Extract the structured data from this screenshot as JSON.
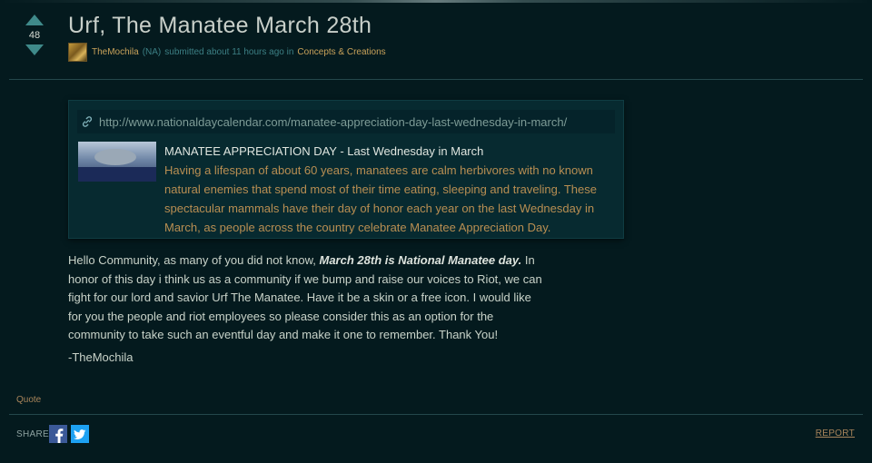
{
  "post": {
    "score": "48",
    "title": "Urf, The Manatee March 28th",
    "author": "TheMochila",
    "region": "(NA)",
    "submitted": "submitted about 11 hours ago in",
    "board": "Concepts & Creations"
  },
  "embed": {
    "url": "http://www.nationaldaycalendar.com/manatee-appreciation-day-last-wednesday-in-march/",
    "headline": "MANATEE APPRECIATION DAY - Last Wednesday in March",
    "description": "Having a lifespan of about 60 years, manatees are calm herbivores with no known natural enemies that spend most of their time eating, sleeping and traveling. These spectacular mammals have their day of honor each year on the last Wednesday in March, as people across the country celebrate Manatee Appreciation Day.",
    "thumbnail_text": "Manatee Appreciation Day - Last Wednesday in March"
  },
  "body": {
    "intro": "Hello Community, as many of you did not know, ",
    "emphasis": "March 28th is National Manatee day.",
    "rest": " In honor of this day i think us as a community if we bump and raise our voices to Riot, we can fight for our lord and savior Urf The Manatee. Have it be a skin or a free icon. I would like for you the people and riot employees so please consider this as an option for the community to take such an eventful day and make it one to remember. Thank You!",
    "signoff": "-TheMochila"
  },
  "footer": {
    "quote": "Quote",
    "share": "SHARE",
    "facebook_icon": "f",
    "report": "REPORT"
  },
  "colors": {
    "background": "#041a1e",
    "accent_gold": "#c9a25a",
    "accent_teal": "#3f8a8a",
    "facebook": "#3b5998",
    "twitter": "#1da1f2"
  }
}
